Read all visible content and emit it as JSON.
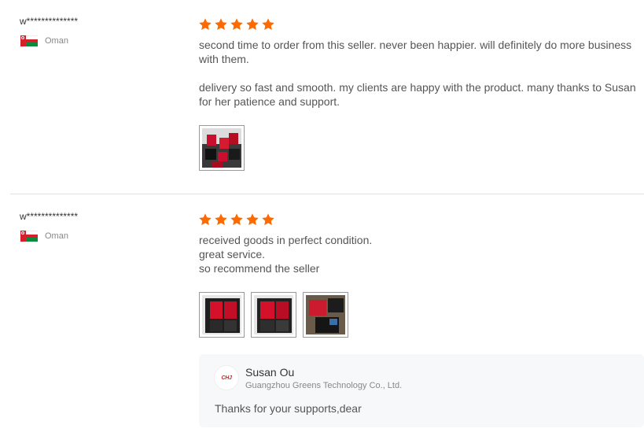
{
  "colors": {
    "star": "#ff6a00",
    "divider": "#e0e0e0",
    "reply_bg": "#f7f8fa"
  },
  "reviews": [
    {
      "user": "w**************",
      "country": "Oman",
      "flag_icon": "oman-flag-icon",
      "rating": 5,
      "paragraphs": [
        "second time to order from this seller. never been happier. will definitely do more business with them.",
        "delivery so fast and smooth. my clients are happy with the product. many thanks to Susan for her patience and support."
      ],
      "photo_count": 1
    },
    {
      "user": "w**************",
      "country": "Oman",
      "flag_icon": "oman-flag-icon",
      "rating": 5,
      "lines": [
        "received goods in perfect condition.",
        "great service.",
        "so recommend the seller"
      ],
      "photo_count": 3,
      "reply": {
        "logo_text": "CHJ",
        "name": "Susan Ou",
        "company": "Guangzhou Greens Technology Co., Ltd.",
        "text": "Thanks for your supports,dear"
      }
    }
  ]
}
